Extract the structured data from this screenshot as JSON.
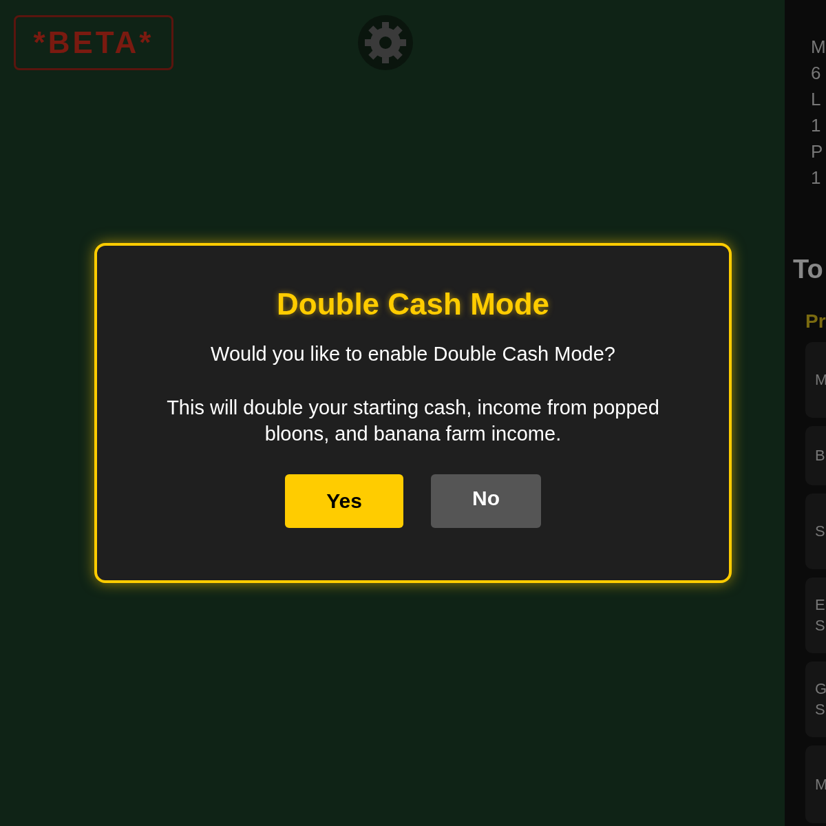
{
  "header": {
    "beta_badge": "*BETA*"
  },
  "side_panel": {
    "stats": [
      "M",
      "6",
      "L",
      "1",
      "P",
      "1"
    ],
    "heading": "To",
    "subheading": "Pr",
    "cards": [
      {
        "lines": [
          "M"
        ]
      },
      {
        "lines": [
          "B"
        ]
      },
      {
        "lines": [
          "S"
        ]
      },
      {
        "lines": [
          "E",
          "S"
        ]
      },
      {
        "lines": [
          "G",
          "S"
        ]
      },
      {
        "lines": [
          "M"
        ]
      }
    ]
  },
  "dialog": {
    "title": "Double Cash Mode",
    "question": "Would you like to enable Double Cash Mode?",
    "description": "This will double your starting cash, income from popped bloons, and banana farm income.",
    "buttons": [
      {
        "label": "Yes",
        "kind": "primary"
      },
      {
        "label": "No",
        "kind": "secondary"
      }
    ]
  }
}
